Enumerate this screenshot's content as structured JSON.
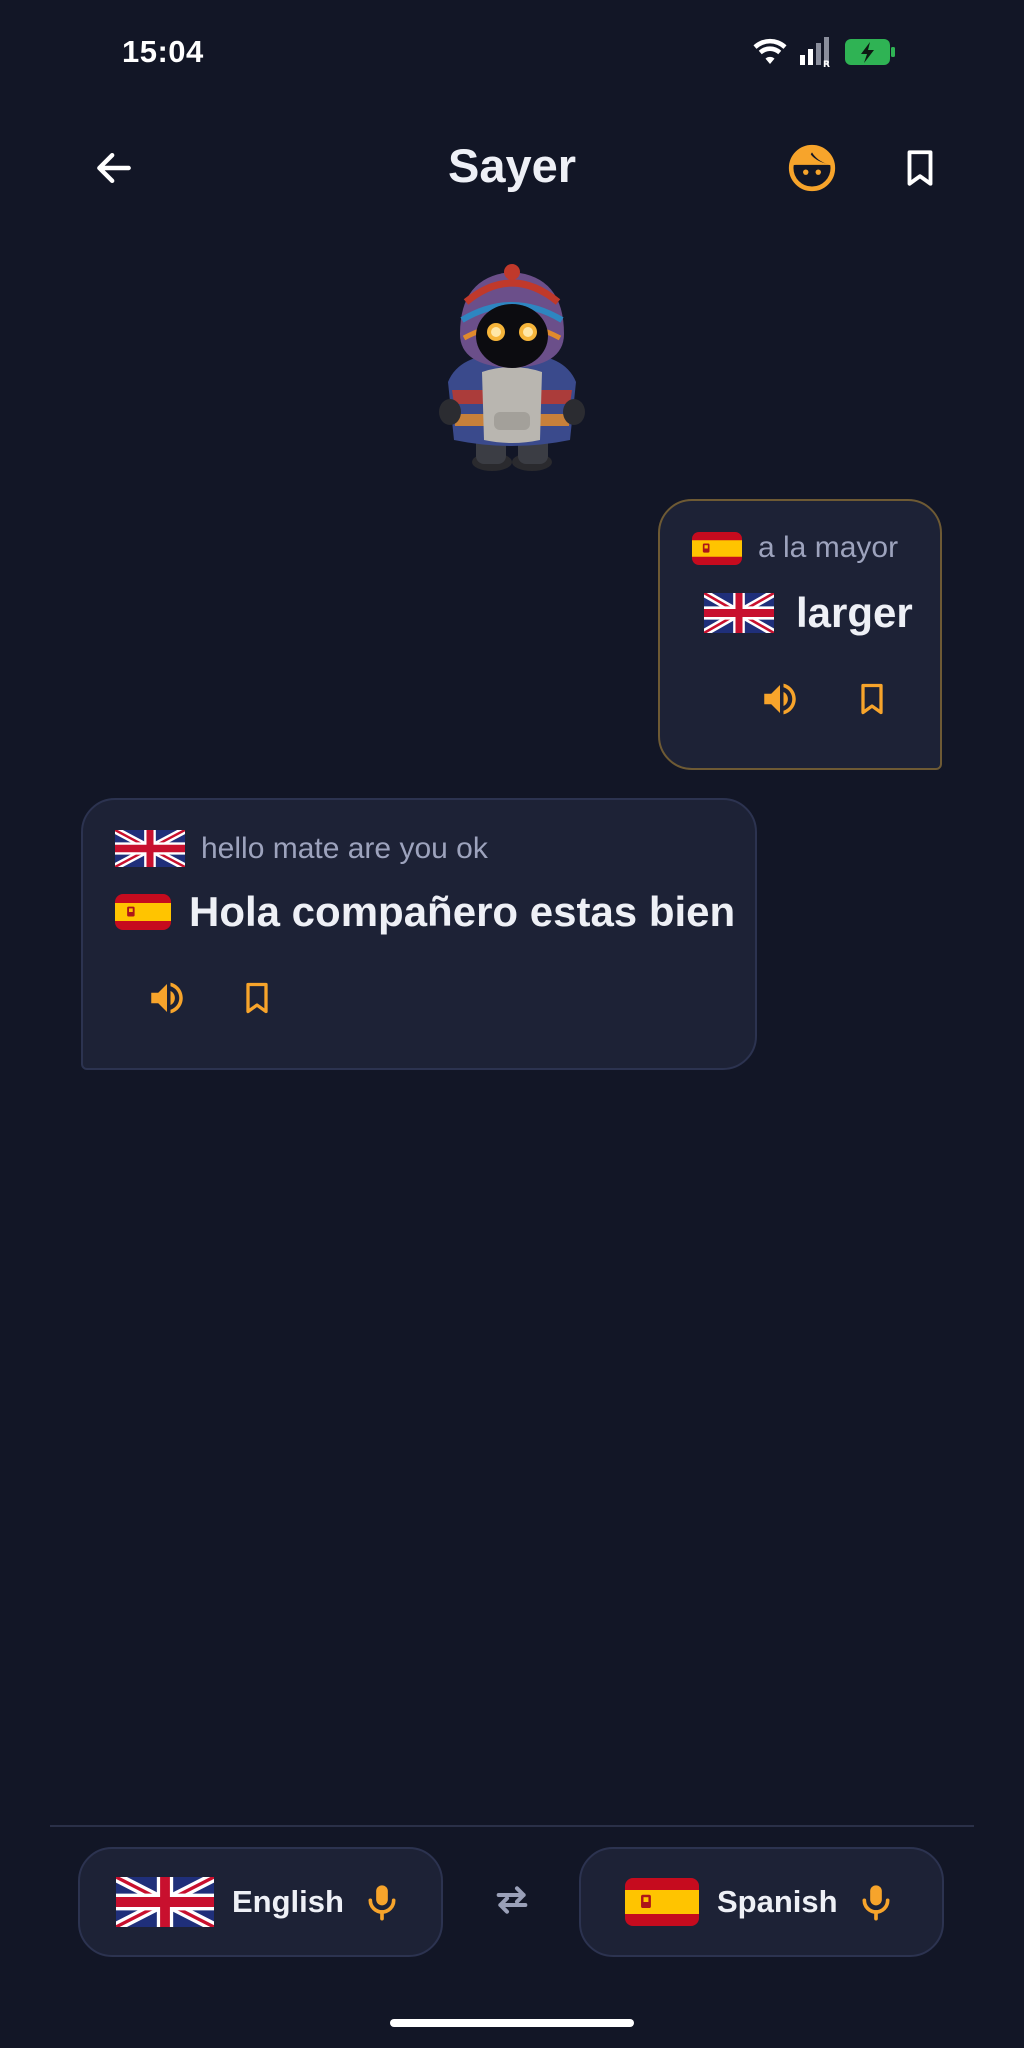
{
  "status_bar": {
    "time": "15:04",
    "icons": [
      "wifi-icon",
      "signal-icon",
      "battery-charging-icon"
    ],
    "battery_color": "#2fb354"
  },
  "app_bar": {
    "title": "Sayer",
    "back_icon": "arrow-left-icon",
    "avatar_icon": "face-icon",
    "bookmarks_icon": "bookmark-icon"
  },
  "colors": {
    "background": "#121626",
    "bubble": "#1d2236",
    "accent": "#f7a42b",
    "text_primary": "#eef0f6",
    "text_secondary": "#9da3bd"
  },
  "messages": [
    {
      "source_lang": "Spanish",
      "source_text": "a la mayor",
      "target_lang": "English",
      "target_text": "larger",
      "actions": [
        "speaker-icon",
        "bookmark-icon"
      ]
    },
    {
      "source_lang": "English",
      "source_text": "hello mate are you ok",
      "target_lang": "Spanish",
      "target_text": "Hola compañero estas bien",
      "actions": [
        "speaker-icon",
        "bookmark-icon"
      ]
    }
  ],
  "language_bar": {
    "left_language": "English",
    "right_language": "Spanish",
    "swap_icon": "swap-arrows-icon",
    "mic_icon": "microphone-icon"
  }
}
